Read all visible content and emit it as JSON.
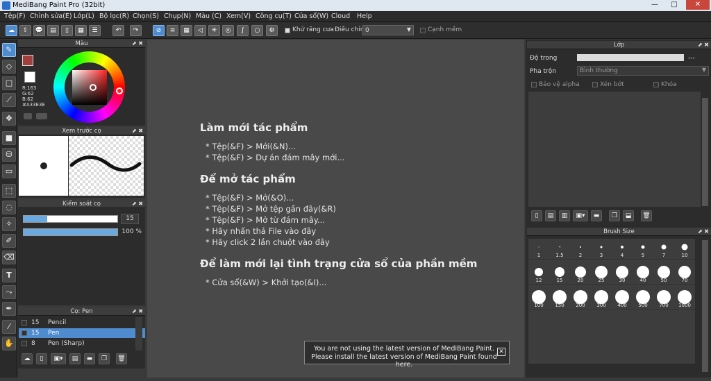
{
  "window": {
    "title": "MediBang Paint Pro (32bit)",
    "min": "—",
    "max": "□",
    "close": "✕"
  },
  "menu": [
    "Tệp(F)",
    "Chỉnh sửa(E)",
    "Lớp(L)",
    "Bộ lọc(R)",
    "Chọn(S)",
    "Chụp(N)",
    "Màu (C)",
    "Xem(V)",
    "Công cụ(T)",
    "Cửa sổ(W)",
    "Cloud",
    "Help"
  ],
  "toolbar": {
    "antialias_label": "Khử răng cưa",
    "adjust_label": "Điều chỉnh",
    "adjust_value": "0",
    "edge_label": "Cạnh mềm"
  },
  "color_panel": {
    "title": "Màu",
    "r": "R:163",
    "g": "G:62",
    "b": "B:62",
    "hex": "#A33E3E",
    "primary_color": "#a33e3e",
    "secondary_color": "#ffffff"
  },
  "brush_preview": {
    "title": "Xem trước cọ"
  },
  "brush_control": {
    "title": "Kiểm soát cọ",
    "size": "15",
    "size_fraction": 0.25,
    "opacity": "100 %",
    "opacity_fraction": 1.0
  },
  "brush_list": {
    "title": "Cọ: Pen",
    "items": [
      {
        "size": "15",
        "name": "Pencil",
        "selected": false
      },
      {
        "size": "15",
        "name": "Pen",
        "selected": true
      },
      {
        "size": "8",
        "name": "Pen (Sharp)",
        "selected": false
      }
    ]
  },
  "welcome": {
    "h1": "Làm mới tác phẩm",
    "new1": "* Tệp(&F) > Mới(&N)...",
    "new2": "* Tệp(&F) > Dự án đám mây mới...",
    "h2": "Để mở tác phẩm",
    "open1": "* Tệp(&F) > Mở(&O)...",
    "open2": "* Tệp(&F) > Mở tệp gần đây(&R)",
    "open3": "* Tệp(&F) > Mở từ đám mây...",
    "open4": "* Hãy nhấn thả File vào đây",
    "open5": "* Hãy click 2 lần chuột vào đây",
    "h3": "Để làm mới lại tình trạng cửa sổ của phần mềm",
    "reset1": "* Cửa sổ(&W) > Khởi tạo(&I)..."
  },
  "notice": {
    "line1": "You are not using the latest version of MediBang Paint.",
    "line2": "Please install the latest version of MediBang Paint found here."
  },
  "layer_panel": {
    "title": "Lớp",
    "opacity_label": "Độ trong",
    "opacity_value": "---",
    "blend_label": "Pha trộn",
    "blend_value": "Bình thường",
    "protect_alpha": "Bảo vệ alpha",
    "clip": "Xén bớt",
    "lock": "Khóa"
  },
  "brush_size_panel": {
    "title": "Brush Size",
    "sizes": [
      "1",
      "1.5",
      "2",
      "3",
      "4",
      "5",
      "7",
      "10",
      "12",
      "15",
      "20",
      "25",
      "30",
      "40",
      "50",
      "70",
      "100",
      "150",
      "200",
      "300",
      "400",
      "500",
      "700",
      "1000"
    ]
  }
}
